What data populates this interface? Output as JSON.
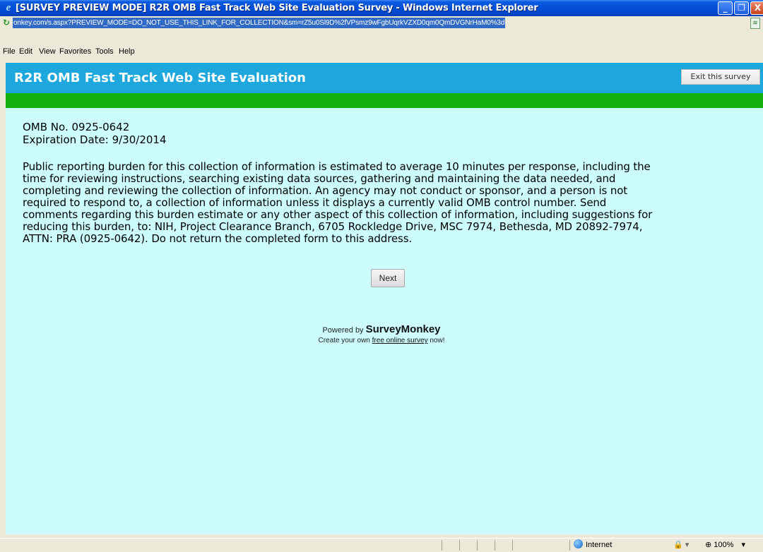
{
  "window": {
    "title": "[SURVEY PREVIEW MODE] R2R OMB Fast Track Web Site Evaluation Survey - Windows Internet Explorer",
    "minimize": "_",
    "maximize": "❐",
    "close": "X"
  },
  "address": {
    "url": "onkey.com/s.aspx?PREVIEW_MODE=DO_NOT_USE_THIS_LINK_FOR_COLLECTION&sm=rZ5u0Sl9D%2fVPsmz9wFgbUqrkVZXD0qm0QmDVGNrHaM0%3d"
  },
  "menu": {
    "items": [
      "File",
      "Edit",
      "View",
      "Favorites",
      "Tools",
      "Help"
    ]
  },
  "survey": {
    "title": "R2R OMB Fast Track Web Site Evaluation",
    "exit_label": "Exit this survey",
    "omb_number": "OMB No. 0925-0642",
    "expiration": "Expiration Date: 9/30/2014",
    "burden_lines": [
      "Public reporting burden for this collection of information is estimated to average 10 minutes per response, including the",
      "time for reviewing instructions, searching existing data sources, gathering and maintaining the data needed, and",
      "completing and reviewing the collection of information. An agency may not conduct or sponsor, and a person is not",
      "required to respond to, a collection of information unless it displays a currently valid OMB control number. Send",
      "comments regarding this burden estimate or any other aspect of this collection of information, including suggestions for",
      "reducing this burden, to: NIH, Project Clearance Branch, 6705 Rockledge Drive, MSC 7974, Bethesda, MD 20892-7974,",
      "ATTN: PRA (0925-0642). Do not return the completed form to this address."
    ],
    "next_label": "Next"
  },
  "footer": {
    "powered_prefix": "Powered by",
    "brand": "SurveyMonkey",
    "create_prefix": "Create your own",
    "create_link": "free online survey",
    "create_suffix": "now!"
  },
  "status": {
    "zone": "Internet",
    "protected_mode": "🔒 ▾",
    "zoom": "100%",
    "zoom_arrow": "▾"
  },
  "colors": {
    "header_blue": "#1da7dc",
    "green_bar": "#15b20f",
    "page_bg": "#ccfcfc"
  }
}
